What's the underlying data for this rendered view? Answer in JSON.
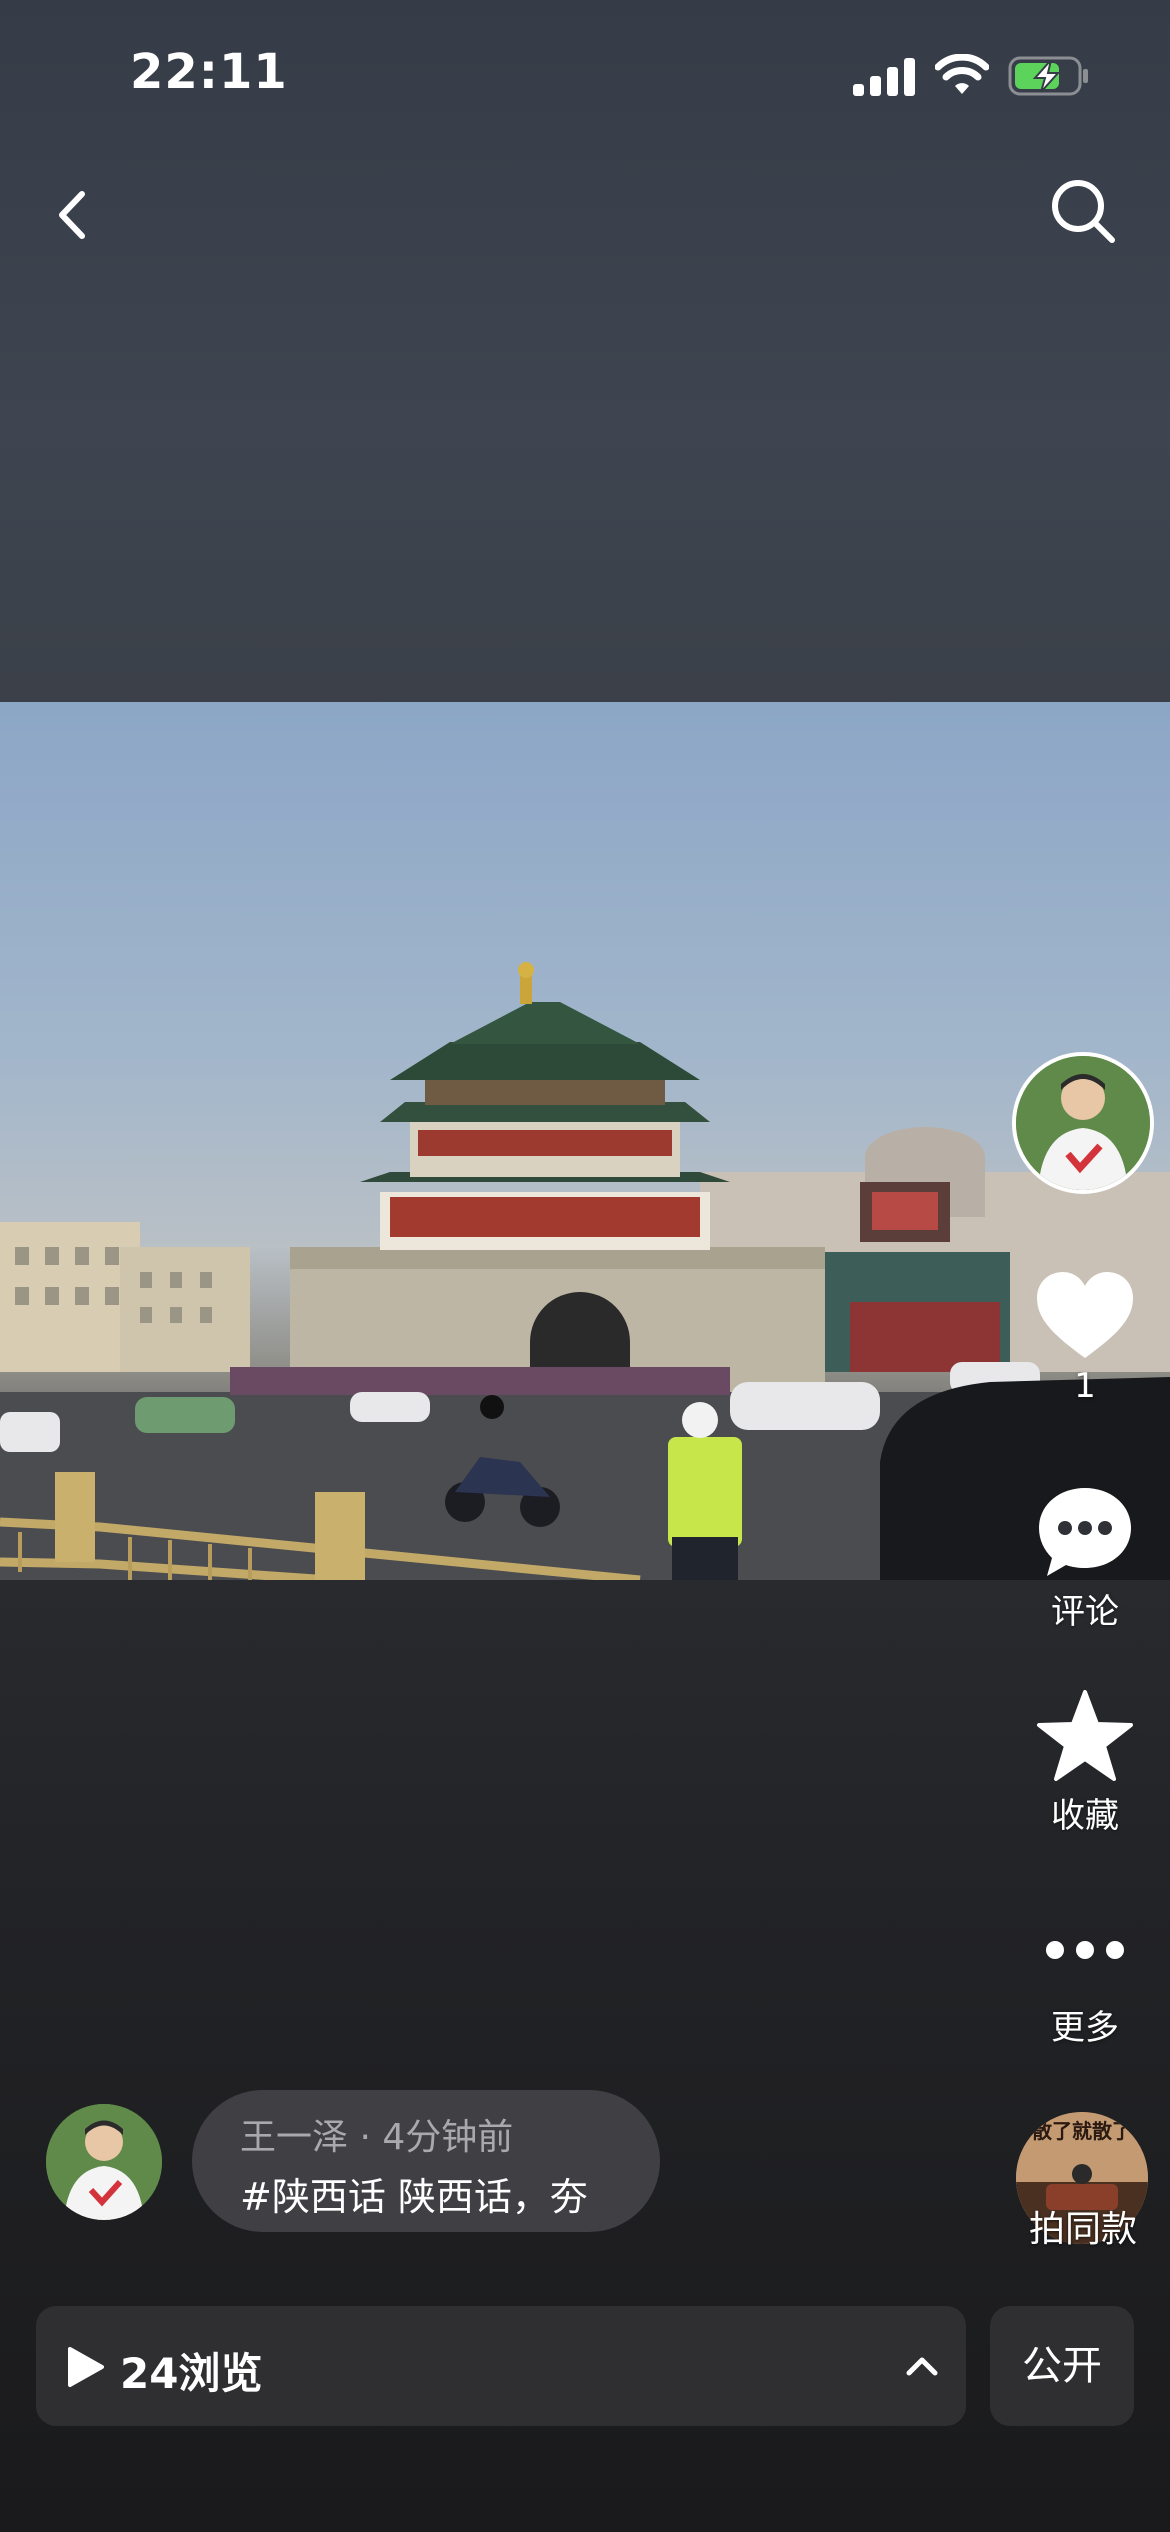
{
  "status": {
    "time": "22:11"
  },
  "actions": {
    "like_count": "1",
    "comment_label": "评论",
    "favorite_label": "收藏",
    "more_label": "更多"
  },
  "post": {
    "author": "王一泽",
    "posted_ago": "4分钟前",
    "caption": "#陕西话 陕西话，夯",
    "meta": "王一泽 · 4分钟前"
  },
  "same_style": {
    "thumb_text": "散了就散了",
    "label": "拍同款"
  },
  "footer": {
    "views_label": "24浏览",
    "visibility_label": "公开"
  },
  "colors": {
    "background": "#2c2e32",
    "pill": "#2f2f31",
    "battery_green": "#5cd35a"
  }
}
